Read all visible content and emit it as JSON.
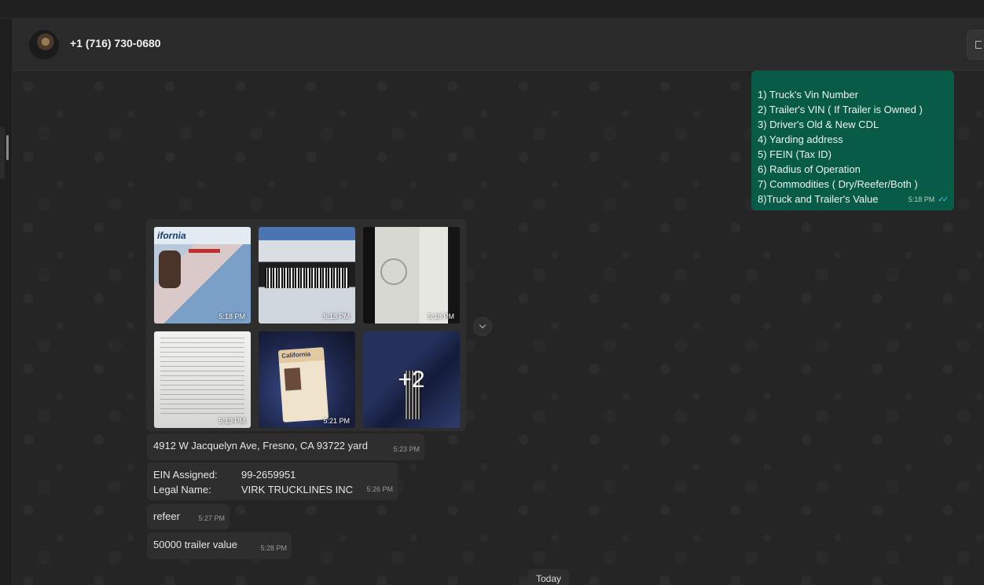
{
  "header": {
    "contact_name": "+1 (716) 730-0680"
  },
  "outgoing_message": {
    "lines": [
      "1) Truck's Vin Number",
      "2) Trailer's VIN ( If Trailer is Owned )",
      "3) Driver's Old & New CDL",
      "4) Yarding address",
      "5) FEIN (Tax ID)",
      "6) Radius of Operation",
      "7) Commodities ( Dry/Reefer/Both )",
      "8)Truck and Trailer's Value"
    ],
    "time": "5:18 PM",
    "status_icon": "read-double-check-icon"
  },
  "album": {
    "thumbnails": [
      {
        "label": "ifornia",
        "time": "5:18 PM"
      },
      {
        "time": "5:18 PM"
      },
      {
        "time": "5:18 PM"
      },
      {
        "time": "5:19 PM"
      },
      {
        "label": "California",
        "time": "5:21 PM"
      },
      {
        "more_count": "+2"
      }
    ]
  },
  "incoming_messages": [
    {
      "text": "4912 W Jacquelyn Ave, Fresno, CA 93722 yard",
      "time": "5:23 PM"
    },
    {
      "rows": [
        {
          "key": "EIN Assigned:",
          "value": "99-2659951"
        },
        {
          "key": "Legal Name:",
          "value": "VIRK TRUCKLINES INC"
        }
      ],
      "time": "5:26 PM"
    },
    {
      "text": "refeer",
      "time": "5:27 PM"
    },
    {
      "text": "50000 trailer value",
      "time": "5:28 PM"
    }
  ],
  "date_separator": "Today",
  "colors": {
    "outgoing_bubble": "#085c47",
    "incoming_bubble": "#2e2e2e",
    "read_ticks": "#53bdeb"
  }
}
